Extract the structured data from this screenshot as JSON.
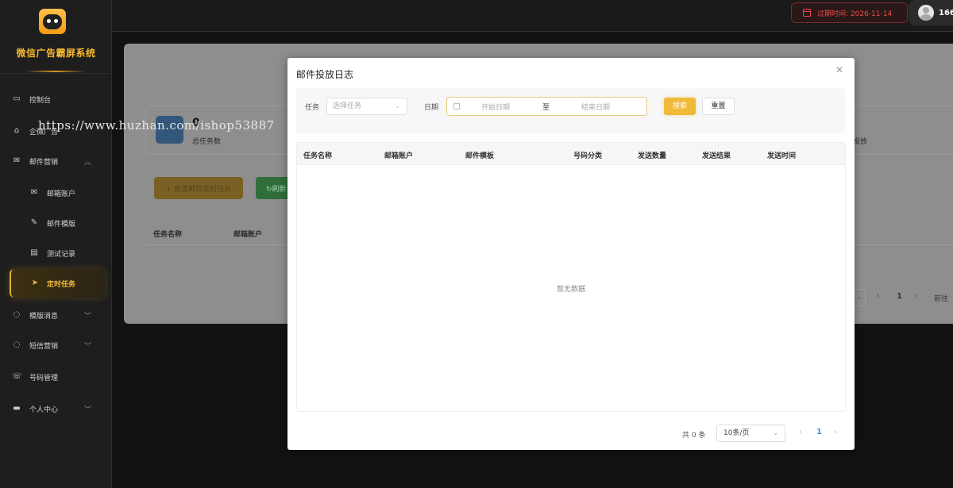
{
  "app": {
    "name": "微信广告霸屏系统"
  },
  "sidebar": {
    "items": [
      {
        "label": "控制台",
        "icon": "monitor-icon"
      },
      {
        "label": "企微广告",
        "icon": "store-icon"
      },
      {
        "label": "邮件营销",
        "icon": "mail-icon",
        "expanded": true
      },
      {
        "label": "邮箱账户",
        "icon": "mail-account-icon",
        "sub": true
      },
      {
        "label": "邮件模版",
        "icon": "edit-icon",
        "sub": true
      },
      {
        "label": "测试记录",
        "icon": "clipboard-icon",
        "sub": true
      },
      {
        "label": "定时任务",
        "icon": "send-icon",
        "sub": true,
        "active": true
      },
      {
        "label": "模版消息",
        "icon": "chat-icon"
      },
      {
        "label": "短信营销",
        "icon": "message-icon"
      },
      {
        "label": "号码管理",
        "icon": "phone-icon"
      },
      {
        "label": "个人中心",
        "icon": "user-center-icon"
      }
    ]
  },
  "topbar": {
    "expire_label": "过期时间: 2026-11-14",
    "user_name": "166"
  },
  "watermark": "https://www.huzhan.com/ishop53887",
  "background": {
    "stat_value": "0",
    "stat_label": "总任务数",
    "right_stat_label": "投放",
    "new_task_button": "+ 新建邮件定时任务",
    "refresh_button": "↻刷新",
    "table_headers": [
      "任务名称",
      "邮箱账户"
    ],
    "pager_current": "1",
    "goto_label": "前往"
  },
  "modal": {
    "title": "邮件投放日志",
    "filters": {
      "task_label": "任务",
      "task_placeholder": "选择任务",
      "date_label": "日期",
      "start_placeholder": "开始日期",
      "range_separator": "至",
      "end_placeholder": "结束日期",
      "search_button": "搜索",
      "reset_button": "重置"
    },
    "table": {
      "columns": [
        "任务名称",
        "邮箱账户",
        "邮件模板",
        "号码分类",
        "发送数量",
        "发送结果",
        "发送时间"
      ],
      "empty_text": "暂无数据"
    },
    "pagination": {
      "total": "共 0 条",
      "page_size": "10条/页",
      "current_page": "1"
    }
  },
  "colors": {
    "accent": "#f0b93a",
    "expire_red": "#ef4b4b",
    "page_link": "#4a8fe0"
  }
}
